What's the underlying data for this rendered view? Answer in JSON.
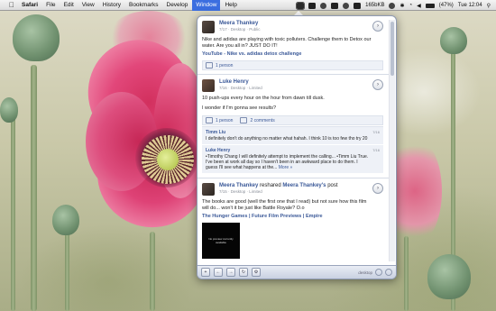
{
  "menubar": {
    "apple_icon": "apple-icon",
    "items": [
      {
        "label": "Safari",
        "bold": true
      },
      {
        "label": "File"
      },
      {
        "label": "Edit"
      },
      {
        "label": "View"
      },
      {
        "label": "History"
      },
      {
        "label": "Bookmarks"
      },
      {
        "label": "Develop"
      },
      {
        "label": "Window",
        "active": true
      },
      {
        "label": "Help"
      }
    ],
    "status": {
      "wifi_speed": "165bKB",
      "battery": "(47%)",
      "day_time": "Tue 12:04"
    }
  },
  "feed": {
    "posts": [
      {
        "author": "Meera Thankey",
        "meta": "7/17 · Desktop · Public",
        "text": "Nike and adidas are playing with toxic polluters. Challenge them to Detox our water. Are you all in? JUST DO IT!",
        "link": "YouTube - Nike vs. adidas detox challenge",
        "likes": "1 person"
      },
      {
        "author": "Luke Henry",
        "meta": "7/16 · Desktop · Limited",
        "text": "10 push-ups every hour on the hour from dawn till dusk.",
        "text2": "I wonder if I'm gonna see results?",
        "likes": "1 person",
        "comments_label": "2 comments",
        "comments": [
          {
            "author": "Timm Liu",
            "time": "7/16",
            "text": "I definitely don't do anything no matter what hahah. I think 10 is too few tho try 20"
          },
          {
            "author": "Luke Henry",
            "time": "7/16",
            "text": "•Timothy Chang I will definitely attempt to implement the calling... •Timm Liu True. I've been at work all day so I haven't been in an awkward place to do them. I guess I'll see what happens at the...",
            "more": "More »"
          }
        ]
      },
      {
        "author": "Meera Thankey",
        "reshare_text": "reshared",
        "reshare_target": "Meera Thankey's",
        "reshare_suffix": "post",
        "meta": "7/15 · Desktop · Limited",
        "text": "The books are good (well the first one that I read) but not sure how this film will do... won't it be just like Battle Royale? O.o",
        "link": "The Hunger Games | Future Film Previews | Empire",
        "thumb_caption": "No preview currently available"
      }
    ]
  },
  "bottombar": {
    "status_text": "desktop"
  }
}
